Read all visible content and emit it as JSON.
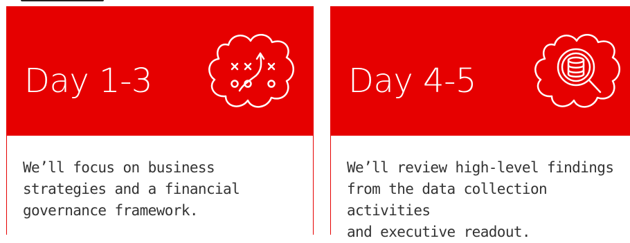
{
  "colors": {
    "accent": "#e60000",
    "text": "#333333",
    "icon": "#ffffff"
  },
  "cards": [
    {
      "title": "Day 1-3",
      "icon": "strategy-playbook-icon",
      "description_lines": [
        "We’ll focus on business",
        "strategies and a financial",
        "governance framework."
      ]
    },
    {
      "title": "Day 4-5",
      "icon": "data-search-icon",
      "description_lines": [
        "We’ll review high-level findings",
        "from the data collection activities",
        "and executive readout."
      ]
    }
  ]
}
